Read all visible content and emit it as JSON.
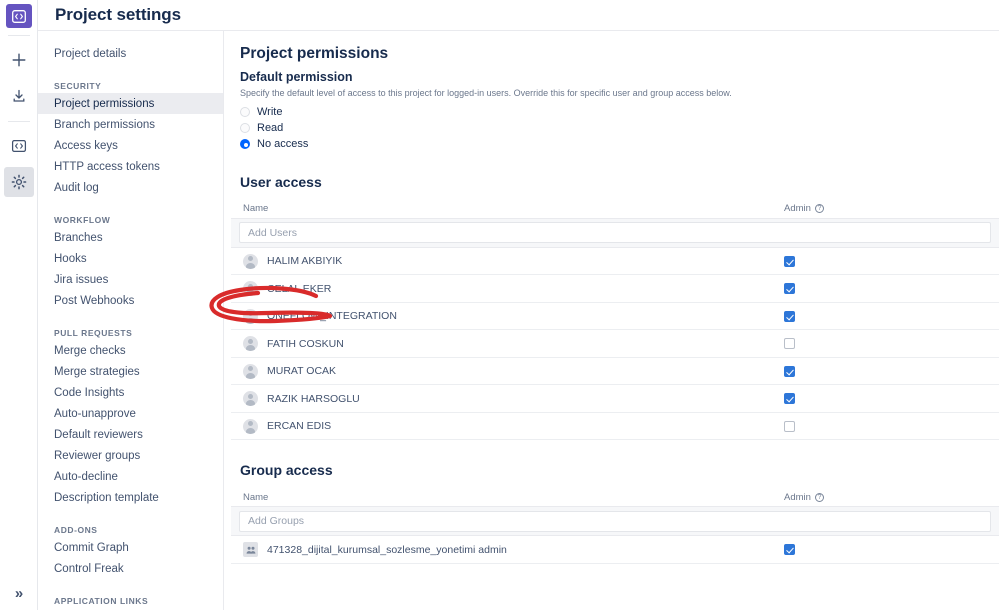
{
  "window": {
    "title": "Project settings"
  },
  "rail": {
    "items": [
      {
        "name": "app-logo-icon",
        "label": "Bitbucket"
      },
      {
        "name": "create-icon",
        "label": "Create"
      },
      {
        "name": "import-icon",
        "label": "Import repository"
      },
      {
        "name": "repositories-icon",
        "label": "Repositories"
      },
      {
        "name": "settings-icon",
        "label": "Settings"
      }
    ],
    "expand_label": "»"
  },
  "sidebar": {
    "top_items": [
      {
        "label": "Project details",
        "selected": false
      }
    ],
    "sections": [
      {
        "heading": "SECURITY",
        "items": [
          {
            "label": "Project permissions",
            "selected": true
          },
          {
            "label": "Branch permissions",
            "selected": false
          },
          {
            "label": "Access keys",
            "selected": false
          },
          {
            "label": "HTTP access tokens",
            "selected": false
          },
          {
            "label": "Audit log",
            "selected": false
          }
        ]
      },
      {
        "heading": "WORKFLOW",
        "items": [
          {
            "label": "Branches",
            "selected": false
          },
          {
            "label": "Hooks",
            "selected": false
          },
          {
            "label": "Jira issues",
            "selected": false
          },
          {
            "label": "Post Webhooks",
            "selected": false
          }
        ]
      },
      {
        "heading": "PULL REQUESTS",
        "items": [
          {
            "label": "Merge checks",
            "selected": false
          },
          {
            "label": "Merge strategies",
            "selected": false
          },
          {
            "label": "Code Insights",
            "selected": false
          },
          {
            "label": "Auto-unapprove",
            "selected": false
          },
          {
            "label": "Default reviewers",
            "selected": false
          },
          {
            "label": "Reviewer groups",
            "selected": false
          },
          {
            "label": "Auto-decline",
            "selected": false
          },
          {
            "label": "Description template",
            "selected": false
          }
        ]
      },
      {
        "heading": "ADD-ONS",
        "items": [
          {
            "label": "Commit Graph",
            "selected": false
          },
          {
            "label": "Control Freak",
            "selected": false
          }
        ]
      },
      {
        "heading": "APPLICATION LINKS",
        "items": []
      }
    ]
  },
  "main": {
    "page_title": "Project permissions",
    "default_permission": {
      "heading": "Default permission",
      "description": "Specify the default level of access to this project for logged-in users. Override this for specific user and group access below.",
      "options": [
        {
          "label": "Write",
          "selected": false
        },
        {
          "label": "Read",
          "selected": false
        },
        {
          "label": "No access",
          "selected": true
        }
      ]
    },
    "user_access": {
      "heading": "User access",
      "col_name": "Name",
      "col_admin": "Admin",
      "add_placeholder": "Add Users",
      "rows": [
        {
          "name": "HALIM AKBIYIK",
          "admin": true
        },
        {
          "name": "CELAL EKER",
          "admin": true
        },
        {
          "name": "ONEFLOW_INTEGRATION",
          "admin": true
        },
        {
          "name": "FATIH COSKUN",
          "admin": false
        },
        {
          "name": "MURAT OCAK",
          "admin": true
        },
        {
          "name": "RAZIK HARSOGLU",
          "admin": true
        },
        {
          "name": "ERCAN EDIS",
          "admin": false
        }
      ]
    },
    "group_access": {
      "heading": "Group access",
      "col_name": "Name",
      "col_admin": "Admin",
      "add_placeholder": "Add Groups",
      "rows": [
        {
          "name": "471328_dijital_kurumsal_sozlesme_yonetimi admin",
          "admin": true
        }
      ]
    }
  },
  "annotation": {
    "type": "hand-drawn-oval",
    "color": "#d92b2b",
    "targets": "CELAL EKER"
  },
  "colors": {
    "accent_purple": "#6554c0",
    "radio_blue": "#0065ff",
    "checkbox_blue": "#2d76d8",
    "selected_nav_bg": "#ebecf0",
    "annotation_red": "#d92b2b"
  }
}
